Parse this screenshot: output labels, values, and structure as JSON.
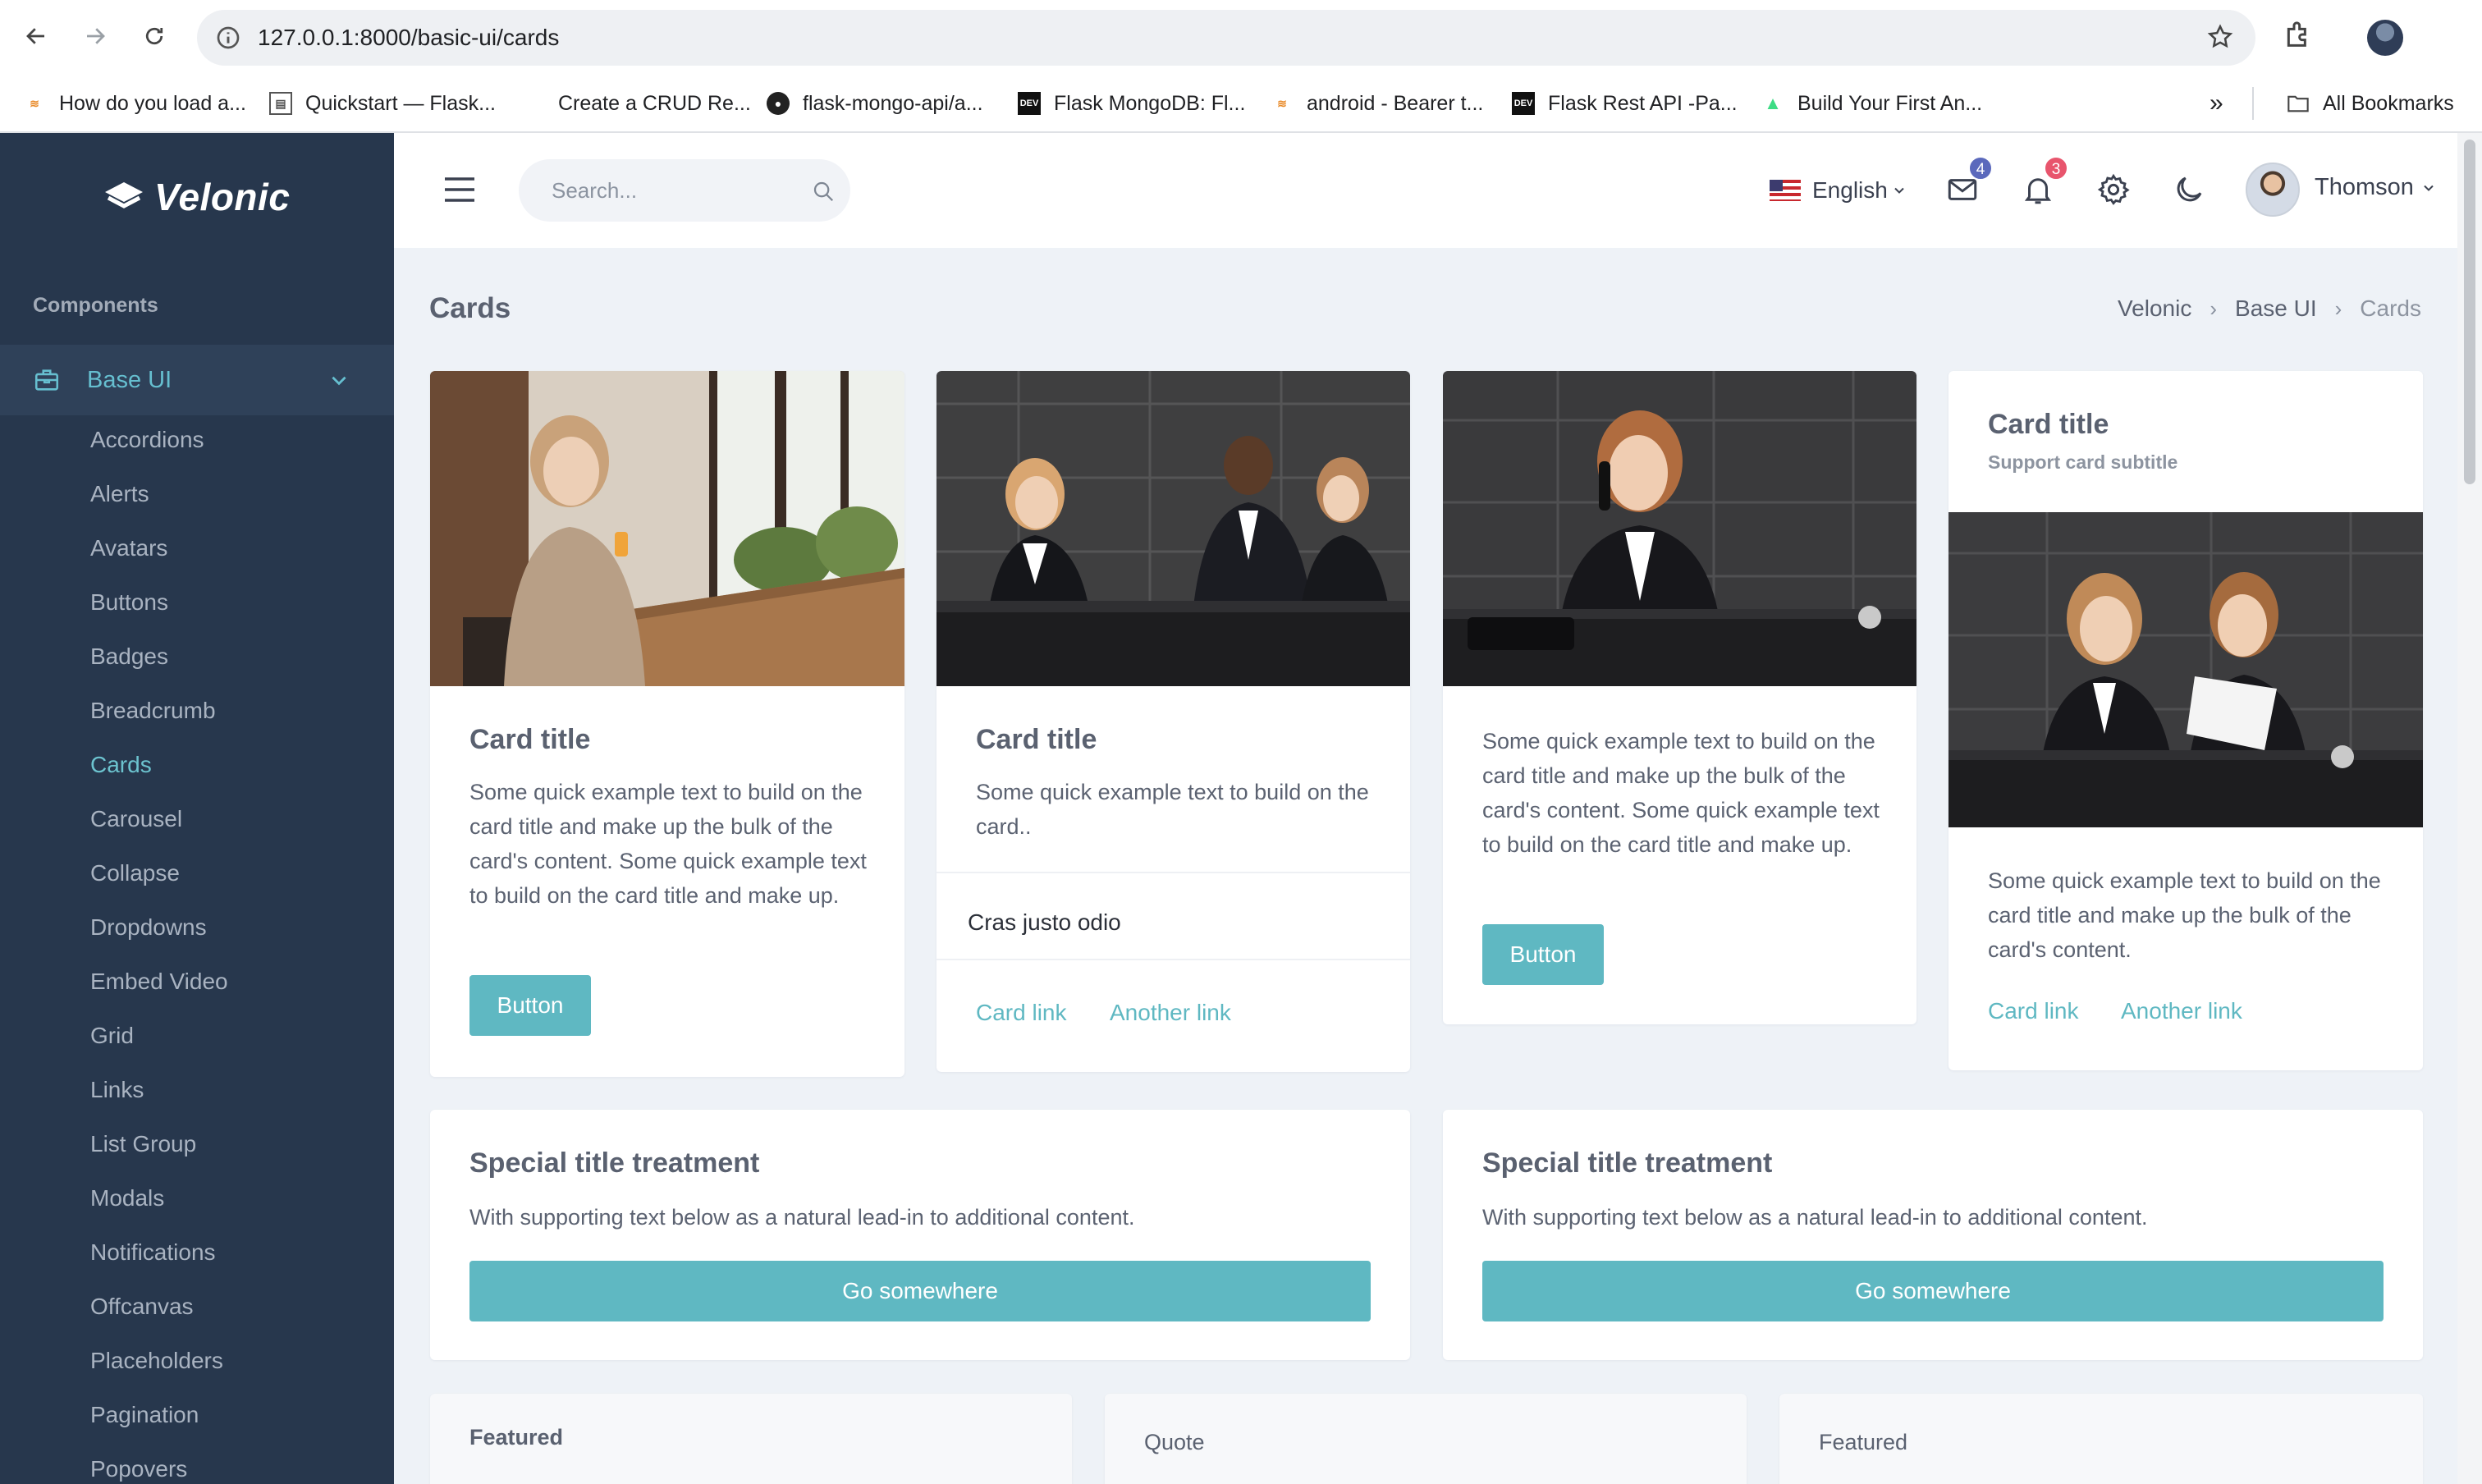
{
  "browser": {
    "url": "127.0.0.1:8000/basic-ui/cards",
    "bookmarks": [
      "How do you load a...",
      "Quickstart — Flask...",
      "Create a CRUD Re...",
      "flask-mongo-api/a...",
      "Flask MongoDB: Fl...",
      "android - Bearer t...",
      "Flask Rest API -Pa...",
      "Build Your First An..."
    ],
    "all_bookmarks": "All Bookmarks"
  },
  "sidebar": {
    "brand": "Velonic",
    "section": "Components",
    "group": "Base UI",
    "items": [
      "Accordions",
      "Alerts",
      "Avatars",
      "Buttons",
      "Badges",
      "Breadcrumb",
      "Cards",
      "Carousel",
      "Collapse",
      "Dropdowns",
      "Embed Video",
      "Grid",
      "Links",
      "List Group",
      "Modals",
      "Notifications",
      "Offcanvas",
      "Placeholders",
      "Pagination",
      "Popovers"
    ],
    "active_item": "Cards"
  },
  "topbar": {
    "search_placeholder": "Search...",
    "language": "English",
    "mail_count": "4",
    "notif_count": "3",
    "user": "Thomson",
    "colors": {
      "mail_badge": "#5b69bc",
      "notif_badge": "#e8556d"
    }
  },
  "page": {
    "title": "Cards",
    "breadcrumb": [
      "Velonic",
      "Base UI",
      "Cards"
    ]
  },
  "cards": {
    "c1": {
      "title": "Card title",
      "text": "Some quick example text to build on the card title and make up the bulk of the card's content. Some quick example text to build on the card title and make up.",
      "button": "Button"
    },
    "c2": {
      "title": "Card title",
      "text": "Some quick example text to build on the card..",
      "list_item": "Cras justo odio",
      "link1": "Card link",
      "link2": "Another link"
    },
    "c3": {
      "text": "Some quick example text to build on the card title and make up the bulk of the card's content. Some quick example text to build on the card title and make up.",
      "button": "Button"
    },
    "c4": {
      "title": "Card title",
      "subtitle": "Support card subtitle",
      "text": "Some quick example text to build on the card title and make up the bulk of the card's content.",
      "link1": "Card link",
      "link2": "Another link"
    },
    "special1": {
      "title": "Special title treatment",
      "text": "With supporting text below as a natural lead-in to additional content.",
      "button": "Go somewhere"
    },
    "special2": {
      "title": "Special title treatment",
      "text": "With supporting text below as a natural lead-in to additional content.",
      "button": "Go somewhere"
    },
    "bottom": [
      "Featured",
      "Quote",
      "Featured"
    ]
  },
  "colors": {
    "accent": "#5fb8c2",
    "sidebar": "#27374d",
    "background": "#eef2f7"
  }
}
